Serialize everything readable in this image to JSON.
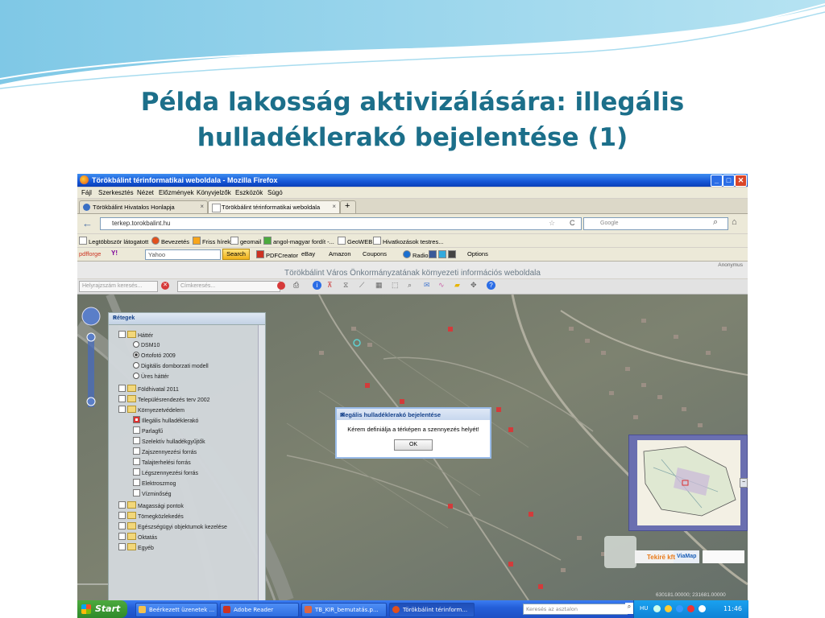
{
  "slide": {
    "title_line1": "Példa lakosság aktivizálására: illegális",
    "title_line2": "hulladéklerakó bejelentése (1)"
  },
  "window": {
    "title": "Törökbálint térinformatikai weboldala - Mozilla Firefox"
  },
  "menu": [
    "Fájl",
    "Szerkesztés",
    "Nézet",
    "Előzmények",
    "Könyvjelzők",
    "Eszközök",
    "Súgó"
  ],
  "tabs": [
    {
      "label": "Törökbálint Hivatalos Honlapja",
      "active": false
    },
    {
      "label": "Törökbálint térinformatikai weboldala",
      "active": true
    }
  ],
  "nav": {
    "url": "terkep.torokbalint.hu",
    "search_placeholder": "Google"
  },
  "bookmarks": [
    "Legtöbbször látogatott",
    "Bevezetés",
    "Friss hírek",
    "geomail",
    "angol-magyar fordít -...",
    "GeoWEB",
    "Hivatkozások testres..."
  ],
  "toolbar2": {
    "brand": "pdfforge",
    "yahoo_placeholder": "Yahoo",
    "search_btn": "Search",
    "items": [
      "PDFCreator",
      "eBay",
      "Amazon",
      "Coupons",
      "Radio",
      "Options"
    ]
  },
  "site": {
    "user": "Anonymus",
    "title": "Törökbálint Város Önkormányzatának környezeti információs weboldala",
    "place_search_placeholder": "Helyrajzszám keresés...",
    "address_search_placeholder": "Címkeresés..."
  },
  "layers": {
    "header": "Rétegek",
    "items": [
      {
        "label": "Háttér",
        "level": 0,
        "kind": "group"
      },
      {
        "label": "DSM10",
        "level": 1,
        "kind": "radio"
      },
      {
        "label": "Ortofotó 2009",
        "level": 1,
        "kind": "radio-checked"
      },
      {
        "label": "Digitális domborzati modell",
        "level": 1,
        "kind": "radio"
      },
      {
        "label": "Üres háttér",
        "level": 1,
        "kind": "radio"
      },
      {
        "label": "Földhivatal 2011",
        "level": 0,
        "kind": "group"
      },
      {
        "label": "Településrendezés terv 2002",
        "level": 0,
        "kind": "group"
      },
      {
        "label": "Környezetvédelem",
        "level": 0,
        "kind": "group"
      },
      {
        "label": "Illegális hulladéklerakó",
        "level": 1,
        "kind": "check"
      },
      {
        "label": "Parlagfű",
        "level": 1,
        "kind": "check"
      },
      {
        "label": "Szelektív hulladékgyűjtők",
        "level": 1,
        "kind": "check"
      },
      {
        "label": "Zajszennyezési forrás",
        "level": 1,
        "kind": "check"
      },
      {
        "label": "Talajterhelési forrás",
        "level": 1,
        "kind": "check"
      },
      {
        "label": "Légszennyezési forrás",
        "level": 1,
        "kind": "check"
      },
      {
        "label": "Elektroszmog",
        "level": 1,
        "kind": "check"
      },
      {
        "label": "Vízminőség",
        "level": 1,
        "kind": "check"
      },
      {
        "label": "Magassági pontok",
        "level": 0,
        "kind": "group"
      },
      {
        "label": "Tömegközlekedés",
        "level": 0,
        "kind": "group"
      },
      {
        "label": "Egészségügyi objektumok kezelése",
        "level": 0,
        "kind": "group"
      },
      {
        "label": "Oktatás",
        "level": 0,
        "kind": "group"
      },
      {
        "label": "Egyéb",
        "level": 0,
        "kind": "group"
      }
    ]
  },
  "dialog": {
    "title": "Illegális hulladéklerakó bejelentése",
    "message": "Kérem definiálja a térképen a szennyezés helyét!",
    "ok": "OK"
  },
  "map": {
    "logo_text": "Tekirë kft",
    "logo2": "ViaMap",
    "coords": "630181.00000; 231681.00000"
  },
  "taskbar": {
    "start": "Start",
    "items": [
      {
        "label": "Beérkezett üzenetek ...",
        "active": false
      },
      {
        "label": "Adobe Reader",
        "active": false
      },
      {
        "label": "TB_KIR_bemutatás.p...",
        "active": false
      },
      {
        "label": "Törökbálint térinform...",
        "active": true
      }
    ],
    "search_placeholder": "Keresés az asztalon",
    "lang": "HU",
    "clock": "11:46"
  },
  "colors": {
    "title": "#1c6f8a",
    "xp_blue": "#245fd9",
    "start_green": "#2f8a2a"
  }
}
